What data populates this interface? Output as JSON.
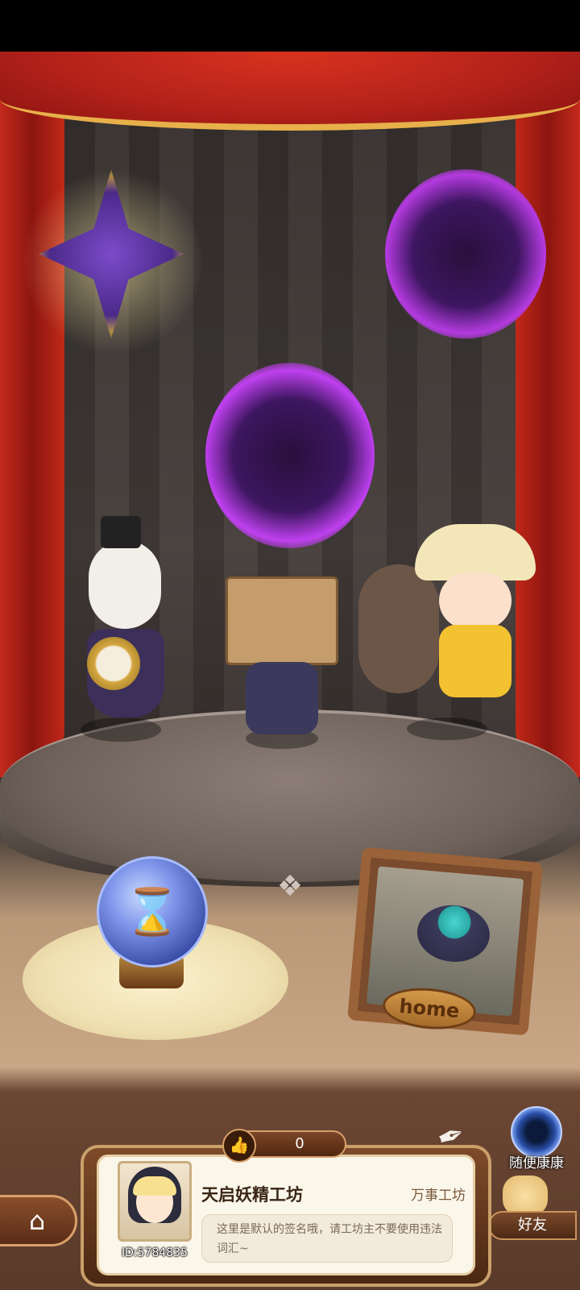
{
  "scene": {
    "emblems": [
      "star-emblem",
      "wolf-emblem",
      "scale-emblem"
    ],
    "characters": [
      "rabbit-girl",
      "box-head-kid",
      "boy-with-monkey"
    ],
    "home_plaque": "home",
    "orb_glyph": "⌛"
  },
  "hud": {
    "random_visit_label": "随便康康",
    "friends_label": "好友",
    "home_icon": "⌂",
    "like_icon": "👍",
    "like_count": "0",
    "quill_icon": "✒"
  },
  "profile": {
    "workshop_name": "天启妖精工坊",
    "workshop_type": "万事工坊",
    "signature": "这里是默认的签名哦，请工坊主不要使用违法词汇~",
    "user_id": "ID:5784835"
  },
  "colors": {
    "curtain": "#c42a1c",
    "gold_trim": "#e7b04a",
    "purple_glow": "#c040f0",
    "panel_brown": "#7e4b2a",
    "card_bg": "#fbf6ea"
  }
}
